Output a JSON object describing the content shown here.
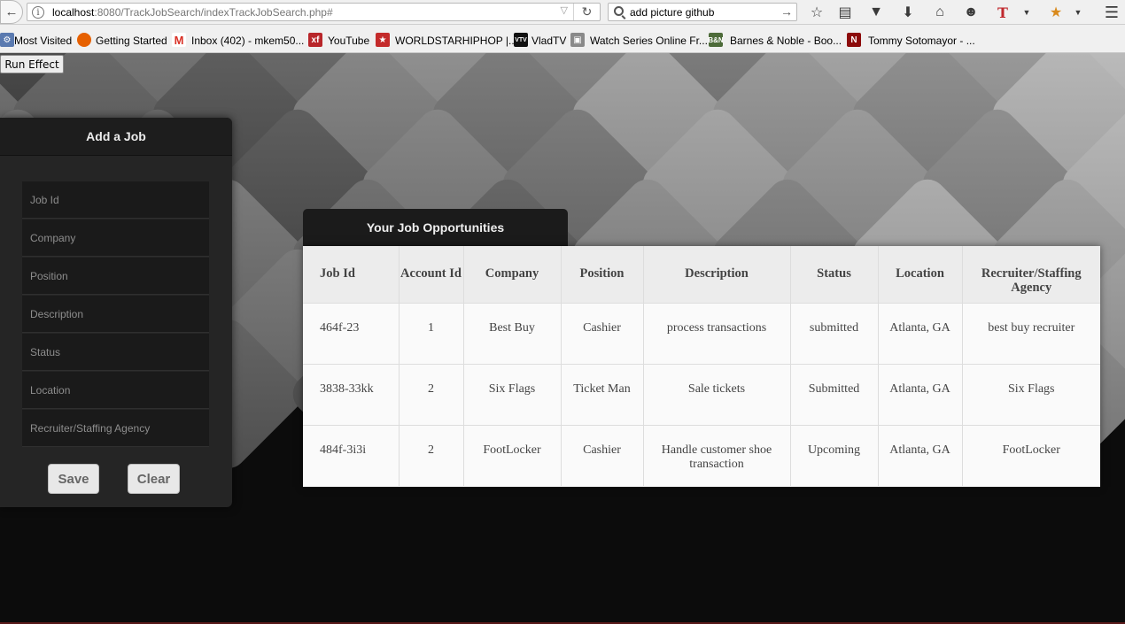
{
  "browser": {
    "url_host": "localhost",
    "url_rest": ":8080/TrackJobSearch/indexTrackJobSearch.php#",
    "search_text": "add picture github"
  },
  "bookmarks": [
    {
      "label": "Most Visited",
      "icon": "gear-icon"
    },
    {
      "label": "Getting Started",
      "icon": "firefox-icon"
    },
    {
      "label": "Inbox (402) - mkem50...",
      "icon": "gmail-icon"
    },
    {
      "label": "YouTube",
      "icon": "xf-icon"
    },
    {
      "label": "WORLDSTARHIPHOP |...",
      "icon": "worldstar-icon"
    },
    {
      "label": "VladTV",
      "icon": "vladtv-icon"
    },
    {
      "label": "Watch Series Online Fr...",
      "icon": "tv-icon"
    },
    {
      "label": "Barnes & Noble - Boo...",
      "icon": "bn-icon"
    },
    {
      "label": "Tommy Sotomayor - ...",
      "icon": "netflix-icon"
    }
  ],
  "run_effect_label": "Run Effect",
  "form": {
    "title": "Add a Job",
    "fields": [
      {
        "placeholder": "Job Id"
      },
      {
        "placeholder": "Company"
      },
      {
        "placeholder": "Position"
      },
      {
        "placeholder": "Description"
      },
      {
        "placeholder": "Status"
      },
      {
        "placeholder": "Location"
      },
      {
        "placeholder": "Recruiter/Staffing Agency"
      }
    ],
    "save_label": "Save",
    "clear_label": "Clear"
  },
  "jobs": {
    "title": "Your Job Opportunities",
    "columns": [
      "Job Id",
      "Account Id",
      "Company",
      "Position",
      "Description",
      "Status",
      "Location",
      "Recruiter/Staffing Agency"
    ],
    "rows": [
      [
        "464f-23",
        "1",
        "Best Buy",
        "Cashier",
        "process transactions",
        "submitted",
        "Atlanta, GA",
        "best buy recruiter"
      ],
      [
        "3838-33kk",
        "2",
        "Six Flags",
        "Ticket Man",
        "Sale tickets",
        "Submitted",
        "Atlanta, GA",
        "Six Flags"
      ],
      [
        "484f-3i3i",
        "2",
        "FootLocker",
        "Cashier",
        "Handle customer shoe transaction",
        "Upcoming",
        "Atlanta, GA",
        "FootLocker"
      ]
    ]
  },
  "colors": {
    "panel": "#252525",
    "header": "#1b1b1b",
    "table_bg": "#fafafa"
  }
}
